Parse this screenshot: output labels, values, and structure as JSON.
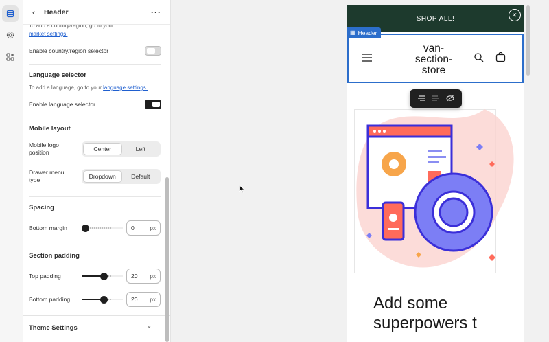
{
  "panel": {
    "title": "Header",
    "country_hint": "To add a country/region, go to your",
    "country_link": "market settings.",
    "enable_country_label": "Enable country/region selector",
    "language_heading": "Language selector",
    "language_hint": "To add a language, go to your",
    "language_link": "language settings.",
    "enable_language_label": "Enable language selector",
    "mobile_heading": "Mobile layout",
    "logo_position_label": "Mobile logo position",
    "logo_position_options": [
      "Center",
      "Left"
    ],
    "drawer_label": "Drawer menu type",
    "drawer_options": [
      "Dropdown",
      "Default"
    ],
    "spacing_heading": "Spacing",
    "bottom_margin_label": "Bottom margin",
    "bottom_margin_value": "0",
    "section_padding_heading": "Section padding",
    "top_padding_label": "Top padding",
    "top_padding_value": "20",
    "bottom_padding_label": "Bottom padding",
    "bottom_padding_value": "20",
    "unit": "px",
    "theme_settings_label": "Theme Settings"
  },
  "preview": {
    "announcement": "SHOP ALL!",
    "selected_tag": "Header",
    "store_name": "van-section-store",
    "hero_text": "Add some superpowers t"
  },
  "colors": {
    "accent": "#2c6ecb",
    "announcement_bg": "#1d3a2d"
  }
}
